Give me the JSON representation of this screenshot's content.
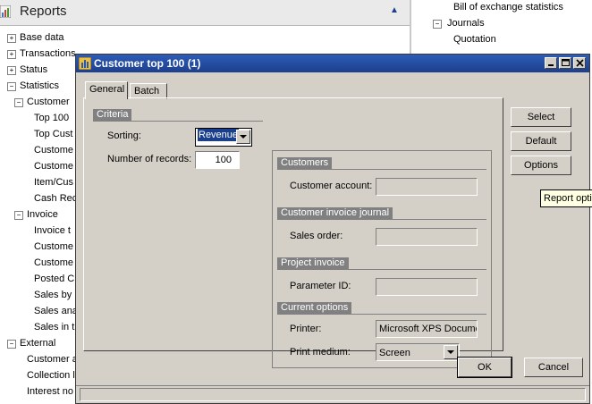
{
  "reports": {
    "title": "Reports",
    "tree": [
      {
        "label": "Base data",
        "level": 0,
        "expander": "+"
      },
      {
        "label": "Transactions",
        "level": 0,
        "expander": "+"
      },
      {
        "label": "Status",
        "level": 0,
        "expander": "+"
      },
      {
        "label": "Statistics",
        "level": 0,
        "expander": "-"
      },
      {
        "label": "Customer",
        "level": 1,
        "expander": "-"
      },
      {
        "label": "Top 100",
        "level": 2
      },
      {
        "label": "Top Cust",
        "level": 2
      },
      {
        "label": "Custome",
        "level": 2
      },
      {
        "label": "Custome",
        "level": 2
      },
      {
        "label": "Item/Cus",
        "level": 2
      },
      {
        "label": "Cash Rec",
        "level": 2
      },
      {
        "label": "Invoice",
        "level": 1,
        "expander": "-"
      },
      {
        "label": "Invoice t",
        "level": 2
      },
      {
        "label": "Custome",
        "level": 2
      },
      {
        "label": "Custome",
        "level": 2
      },
      {
        "label": "Posted C",
        "level": 2
      },
      {
        "label": "Sales by",
        "level": 2
      },
      {
        "label": "Sales ana",
        "level": 2
      },
      {
        "label": "Sales in t",
        "level": 2
      },
      {
        "label": "External",
        "level": 0,
        "expander": "-"
      },
      {
        "label": "Customer a",
        "level": 1
      },
      {
        "label": "Collection l",
        "level": 1
      },
      {
        "label": "Interest no",
        "level": 1
      }
    ],
    "right_pane": {
      "item1": "Bill of exchange statistics",
      "item2": "Journals",
      "item3": "Quotation"
    }
  },
  "dialog": {
    "title": "Customer top 100 (1)",
    "tabs": [
      "General",
      "Batch"
    ],
    "criteria": {
      "group": "Criteria",
      "sorting_label": "Sorting:",
      "sorting_value": "Revenue",
      "records_label": "Number of records:",
      "records_value": "100"
    },
    "customers": {
      "group": "Customers",
      "account_label": "Customer account:",
      "account_value": ""
    },
    "invoice_journal": {
      "group": "Customer invoice journal",
      "sales_order_label": "Sales order:",
      "sales_order_value": ""
    },
    "project_invoice": {
      "group": "Project invoice",
      "param_label": "Parameter ID:",
      "param_value": ""
    },
    "current_options": {
      "group": "Current options",
      "printer_label": "Printer:",
      "printer_value": "Microsoft XPS Docume",
      "medium_label": "Print medium:",
      "medium_value": "Screen"
    },
    "buttons": {
      "select": "Select",
      "default": "Default",
      "options": "Options",
      "ok": "OK",
      "cancel": "Cancel"
    },
    "tooltip": "Report optio"
  }
}
